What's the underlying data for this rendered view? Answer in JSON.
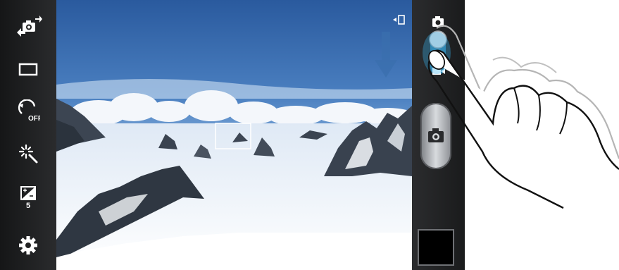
{
  "left_toolbar": {
    "items": [
      {
        "name": "switch-camera",
        "icon": "camera-switch-icon"
      },
      {
        "name": "photo-size",
        "icon": "aspect-ratio-icon"
      },
      {
        "name": "timer",
        "icon": "timer-off-icon",
        "label": "OFF"
      },
      {
        "name": "effects",
        "icon": "magic-wand-icon"
      },
      {
        "name": "exposure",
        "icon": "exposure-icon",
        "label": "5"
      },
      {
        "name": "settings",
        "icon": "gear-icon"
      }
    ]
  },
  "right_toolbar": {
    "mode_switch": {
      "top_icon": "camera-mode-icon",
      "bottom_icon": "video-mode-icon"
    },
    "shutter_icon": "camera-icon",
    "thumbnail": "last-photo-thumbnail",
    "rotate_indicator_icon": "screen-rotate-icon"
  },
  "viewfinder": {
    "scene": "snowy-mountain-landscape",
    "focus_frame": "focus-frame",
    "swipe_hint": "down-arrow-icon"
  },
  "overlay": {
    "gesture": "hand-swipe-down"
  },
  "colors": {
    "sky_top": "#2a5a9e",
    "sky_horizon": "#9ec3e6",
    "snow": "#f2f6fb",
    "bar": "#1e1f21",
    "accent": "#3ab4f2"
  }
}
